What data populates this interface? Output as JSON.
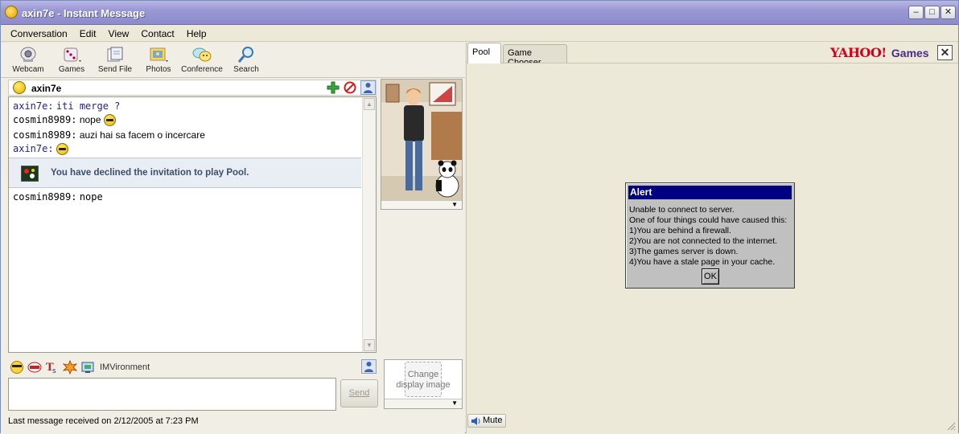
{
  "window": {
    "title": "axin7e - Instant Message"
  },
  "menu": [
    "Conversation",
    "Edit",
    "View",
    "Contact",
    "Help"
  ],
  "toolbar": [
    {
      "label": "Webcam",
      "icon": "webcam-icon"
    },
    {
      "label": "Games",
      "icon": "dice-icon"
    },
    {
      "label": "Send File",
      "icon": "send-file-icon"
    },
    {
      "label": "Photos",
      "icon": "photos-icon"
    },
    {
      "label": "Conference",
      "icon": "conference-icon"
    },
    {
      "label": "Search",
      "icon": "magnifier-icon"
    }
  ],
  "buddy": {
    "name": "axin7e"
  },
  "messages": [
    {
      "sender": "axin7e:",
      "text": "iti merge ?",
      "emoticon": false
    },
    {
      "sender": "cosmin8989:",
      "text": "nope",
      "emoticon": true
    },
    {
      "sender": "cosmin8989:",
      "text": "auzi hai sa facem o incercare",
      "emoticon": false
    },
    {
      "sender": "axin7e:",
      "text": "",
      "emoticon": true
    }
  ],
  "notice": {
    "text": "You have declined the invitation to play Pool."
  },
  "messages_after": [
    {
      "sender": "cosmin8989:",
      "text": "nope"
    }
  ],
  "emobar": {
    "imvironment_label": "IMVironment"
  },
  "send_label": "Send",
  "display_image": {
    "label_line1": "Change",
    "label_line2": "display image"
  },
  "status": {
    "text": "Last message received on 2/12/2005 at 7:23 PM"
  },
  "games": {
    "tabs": [
      "Pool",
      "Game Chooser"
    ],
    "active_tab": "Pool",
    "logo_yahoo": "YAHOO!",
    "logo_games": "Games",
    "mute_label": "Mute"
  },
  "alert": {
    "title": "Alert",
    "lines": [
      "Unable to connect to server.",
      "One of four things could have caused this:",
      "1)You are behind a firewall.",
      "2)You are not connected to the internet.",
      "3)The games server is down.",
      "4)You have a stale page in your cache."
    ],
    "ok_label": "OK"
  },
  "colors": {
    "title_bar": "#9a98d4",
    "alert_header": "#000080",
    "yahoo_red": "#d0021b",
    "sender_me": "#22228e"
  }
}
